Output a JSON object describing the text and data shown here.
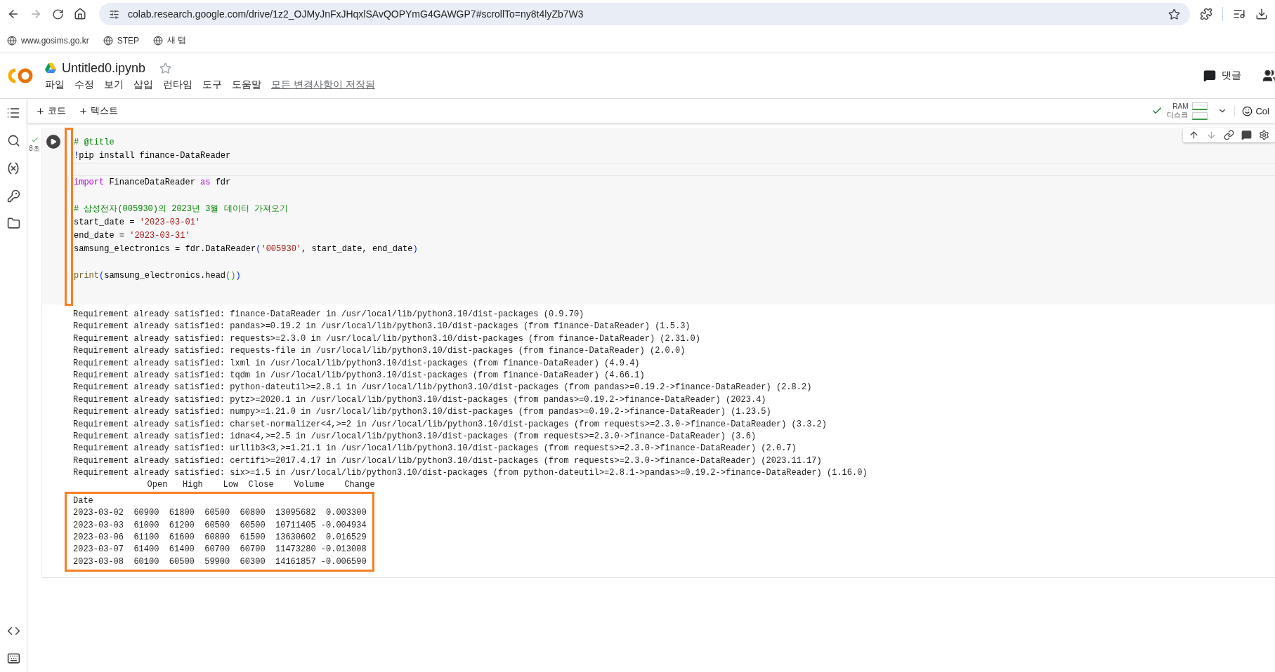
{
  "browser": {
    "url": "colab.research.google.com/drive/1z2_OJMyJnFxJHqxlSAvQOPYmG4GAWGP7#scrollTo=ny8t4lyZb7W3",
    "bookmarks": [
      "www.gosims.go.kr",
      "STEP",
      "새 탭"
    ]
  },
  "notebook": {
    "title": "Untitled0.ipynb",
    "starred": false,
    "menu": [
      "파일",
      "수정",
      "보기",
      "삽입",
      "런타임",
      "도구",
      "도움말"
    ],
    "save_status": "모든 변경사항이 저장됨",
    "comments_label": "댓글"
  },
  "toolbar": {
    "add_buttons": [
      "코드",
      "텍스트"
    ],
    "resources": {
      "connected": true,
      "labels": [
        "RAM",
        "디스크"
      ]
    },
    "overflow_label": "Col"
  },
  "cell": {
    "executed": true,
    "run_time": "8초",
    "code_lines": [
      {
        "kind": "code",
        "tokens": [
          {
            "kind": "comment",
            "text": "# @title"
          }
        ]
      },
      {
        "kind": "code",
        "tokens": [
          {
            "kind": "bang",
            "text": "!"
          },
          {
            "kind": "plain",
            "text": "pip install finance-DataReader"
          }
        ]
      },
      {
        "kind": "active-blank"
      },
      {
        "kind": "code",
        "tokens": [
          {
            "kind": "keyword",
            "text": "import"
          },
          {
            "kind": "plain",
            "text": " FinanceDataReader "
          },
          {
            "kind": "keyword",
            "text": "as"
          },
          {
            "kind": "plain",
            "text": " fdr"
          }
        ]
      },
      {
        "kind": "blank"
      },
      {
        "kind": "code",
        "tokens": [
          {
            "kind": "comment",
            "text": "# 삼성전자(005930)의 2023년 3월 데이터 가져오기"
          }
        ]
      },
      {
        "kind": "code",
        "tokens": [
          {
            "kind": "plain",
            "text": "start_date = "
          },
          {
            "kind": "string",
            "text": "'2023-03-01'"
          }
        ]
      },
      {
        "kind": "code",
        "tokens": [
          {
            "kind": "plain",
            "text": "end_date = "
          },
          {
            "kind": "string",
            "text": "'2023-03-31'"
          }
        ]
      },
      {
        "kind": "code",
        "tokens": [
          {
            "kind": "plain",
            "text": "samsung_electronics = fdr.DataReader"
          },
          {
            "kind": "bracket",
            "text": "("
          },
          {
            "kind": "string",
            "text": "'005930'"
          },
          {
            "kind": "plain",
            "text": ", start_date, end_date"
          },
          {
            "kind": "bracket",
            "text": ")"
          }
        ]
      },
      {
        "kind": "blank"
      },
      {
        "kind": "code",
        "tokens": [
          {
            "kind": "builtin",
            "text": "print"
          },
          {
            "kind": "bracket",
            "text": "("
          },
          {
            "kind": "plain",
            "text": "samsung_electronics.head"
          },
          {
            "kind": "inner-bracket",
            "text": "()"
          },
          {
            "kind": "bracket",
            "text": ")"
          }
        ]
      }
    ],
    "output_lines": [
      "Requirement already satisfied: finance-DataReader in /usr/local/lib/python3.10/dist-packages (0.9.70)",
      "Requirement already satisfied: pandas>=0.19.2 in /usr/local/lib/python3.10/dist-packages (from finance-DataReader) (1.5.3)",
      "Requirement already satisfied: requests>=2.3.0 in /usr/local/lib/python3.10/dist-packages (from finance-DataReader) (2.31.0)",
      "Requirement already satisfied: requests-file in /usr/local/lib/python3.10/dist-packages (from finance-DataReader) (2.0.0)",
      "Requirement already satisfied: lxml in /usr/local/lib/python3.10/dist-packages (from finance-DataReader) (4.9.4)",
      "Requirement already satisfied: tqdm in /usr/local/lib/python3.10/dist-packages (from finance-DataReader) (4.66.1)",
      "Requirement already satisfied: python-dateutil>=2.8.1 in /usr/local/lib/python3.10/dist-packages (from pandas>=0.19.2->finance-DataReader) (2.8.2)",
      "Requirement already satisfied: pytz>=2020.1 in /usr/local/lib/python3.10/dist-packages (from pandas>=0.19.2->finance-DataReader) (2023.4)",
      "Requirement already satisfied: numpy>=1.21.0 in /usr/local/lib/python3.10/dist-packages (from pandas>=0.19.2->finance-DataReader) (1.23.5)",
      "Requirement already satisfied: charset-normalizer<4,>=2 in /usr/local/lib/python3.10/dist-packages (from requests>=2.3.0->finance-DataReader) (3.3.2)",
      "Requirement already satisfied: idna<4,>=2.5 in /usr/local/lib/python3.10/dist-packages (from requests>=2.3.0->finance-DataReader) (3.6)",
      "Requirement already satisfied: urllib3<3,>=1.21.1 in /usr/local/lib/python3.10/dist-packages (from requests>=2.3.0->finance-DataReader) (2.0.7)",
      "Requirement already satisfied: certifi>=2017.4.17 in /usr/local/lib/python3.10/dist-packages (from requests>=2.3.0->finance-DataReader) (2023.11.17)",
      "Requirement already satisfied: six>=1.5 in /usr/local/lib/python3.10/dist-packages (from python-dateutil>=2.8.1->pandas>=0.19.2->finance-DataReader) (1.16.0)"
    ],
    "table": {
      "columns": [
        "Open",
        "High",
        "Low",
        "Close",
        "Volume",
        "Change"
      ],
      "index_name": "Date",
      "rows": [
        {
          "index": "2023-03-02",
          "values": [
            "60900",
            "61800",
            "60500",
            "60800",
            "13095682",
            "0.003300"
          ]
        },
        {
          "index": "2023-03-03",
          "values": [
            "61000",
            "61200",
            "60500",
            "60500",
            "10711405",
            "-0.004934"
          ]
        },
        {
          "index": "2023-03-06",
          "values": [
            "61100",
            "61600",
            "60800",
            "61500",
            "13630602",
            "0.016529"
          ]
        },
        {
          "index": "2023-03-07",
          "values": [
            "61400",
            "61400",
            "60700",
            "60700",
            "11473280",
            "-0.013008"
          ]
        },
        {
          "index": "2023-03-08",
          "values": [
            "60100",
            "60500",
            "59900",
            "60300",
            "14161857",
            "-0.006590"
          ]
        }
      ]
    }
  }
}
